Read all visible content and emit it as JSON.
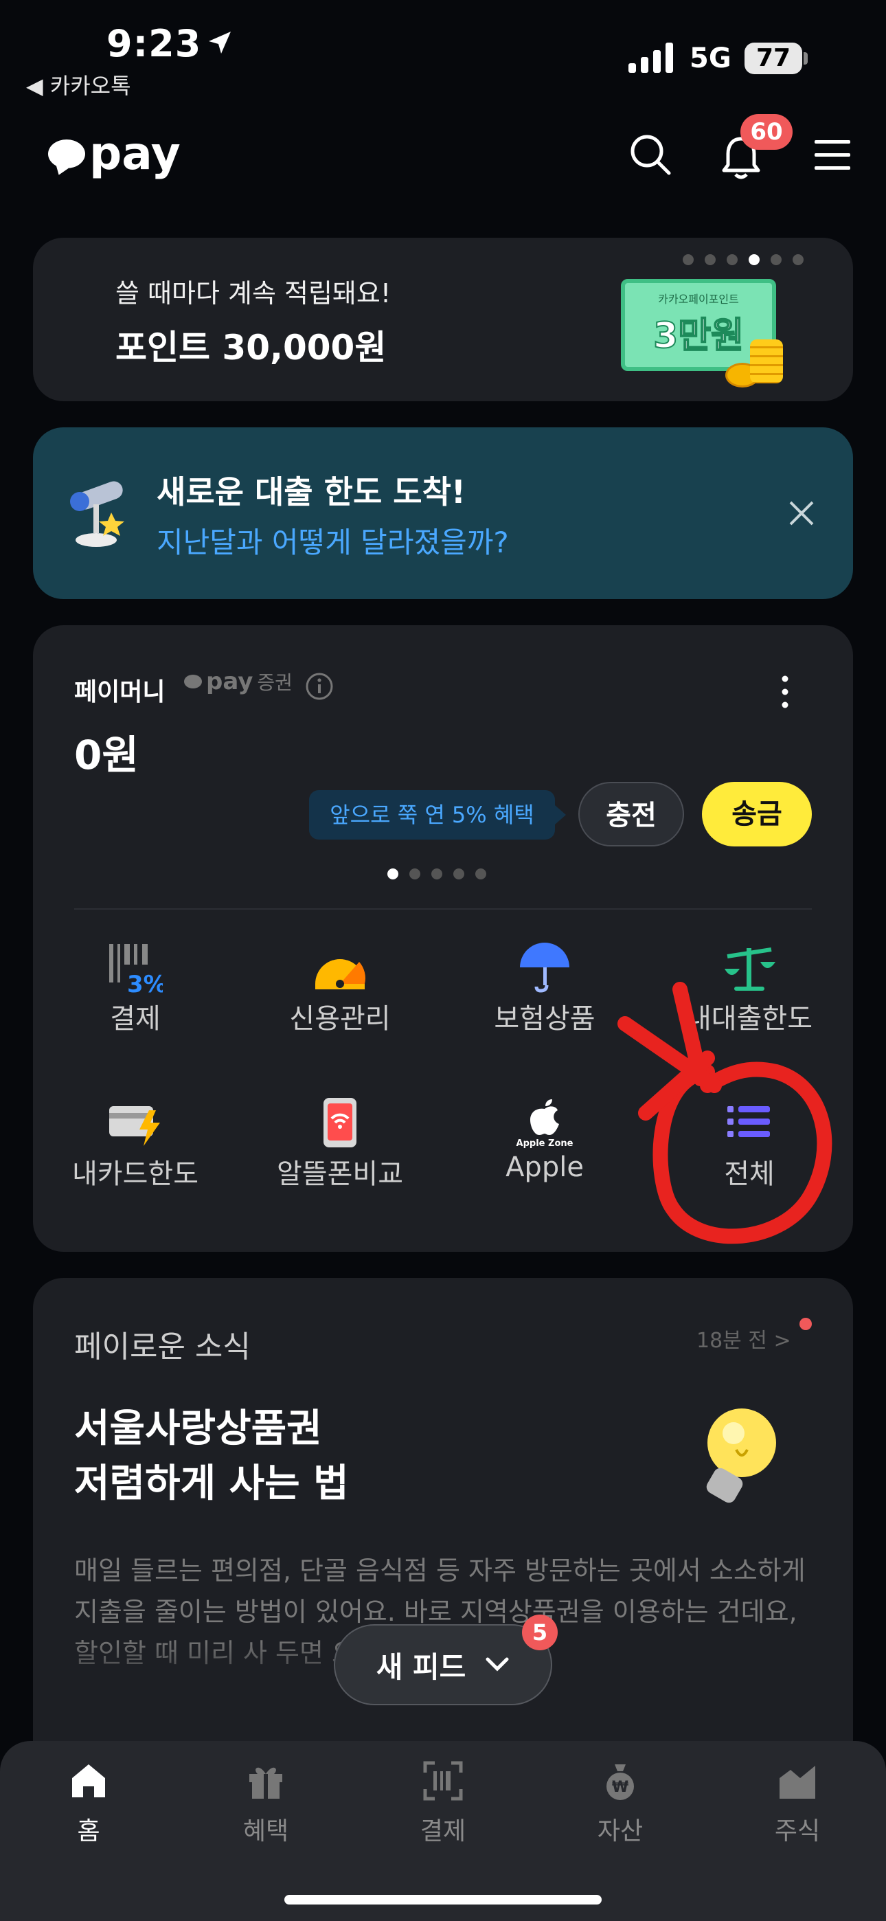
{
  "status_bar": {
    "time": "9:23",
    "back_app": "◀ 카카오톡",
    "network": "5G",
    "battery": "77"
  },
  "header": {
    "logo_text": "pay",
    "notification_count": "60"
  },
  "promo": {
    "subtitle": "쓸 때마다 계속 적립돼요!",
    "title": "포인트 30,000원",
    "image_caption": "카카오페이포인트",
    "image_amount": "3만원"
  },
  "loan_banner": {
    "title": "새로운 대출 한도 도착!",
    "subtitle": "지난달과 어떻게 달라졌을까?"
  },
  "paymoney": {
    "label": "페이머니",
    "partner": "pay",
    "partner_suffix": "증권",
    "balance": "0원",
    "tip": "앞으로 쭉 연 5% 혜택",
    "charge_label": "충전",
    "send_label": "송금"
  },
  "menu": {
    "row1": [
      {
        "label": "결제",
        "icon": "barcode-3percent-icon"
      },
      {
        "label": "신용관리",
        "icon": "credit-gauge-icon"
      },
      {
        "label": "보험상품",
        "icon": "umbrella-icon"
      },
      {
        "label": "내대출한도",
        "icon": "scale-icon"
      }
    ],
    "row2": [
      {
        "label": "내카드한도",
        "icon": "card-bolt-icon"
      },
      {
        "label": "알뜰폰비교",
        "icon": "phone-wifi-icon"
      },
      {
        "label": "Apple",
        "icon": "apple-zone-icon",
        "sub": "Apple Zone"
      },
      {
        "label": "전체",
        "icon": "list-icon"
      }
    ]
  },
  "news": {
    "section": "페이로운 소식",
    "time": "18분 전 >",
    "title_line1": "서울사랑상품권",
    "title_line2": "저렴하게 사는 법",
    "body": "매일 들르는 편의점, 단골 음식점 등 자주 방문하는 곳에서 소소하게 지출을 줄이는 방법이 있어요. 바로 지역상품권을 이용하는 건데요, 할인할 때 미리 사 두면 요긴하"
  },
  "feed_button": {
    "label": "새 피드",
    "badge": "5"
  },
  "tabs": [
    {
      "label": "홈",
      "icon": "home-icon",
      "active": true
    },
    {
      "label": "혜택",
      "icon": "gift-icon"
    },
    {
      "label": "결제",
      "icon": "scan-icon"
    },
    {
      "label": "자산",
      "icon": "money-bag-icon"
    },
    {
      "label": "주식",
      "icon": "chart-icon"
    }
  ],
  "colors": {
    "accent_yellow": "#ffeb3b",
    "badge_red": "#f0595a",
    "link_blue": "#4aa8ff",
    "annotation_red": "#e8231f"
  }
}
